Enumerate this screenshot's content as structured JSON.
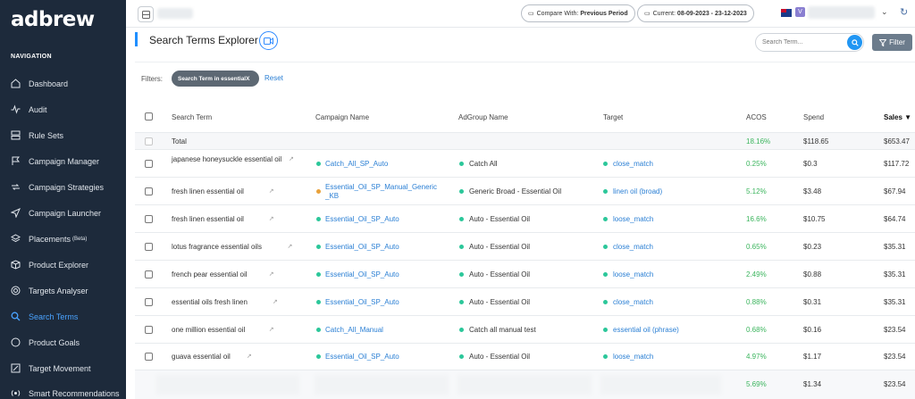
{
  "brand": {
    "logo_text": "adbrew"
  },
  "sidebar": {
    "heading": "NAVIGATION",
    "items": [
      {
        "label": "Dashboard",
        "icon": "home-icon"
      },
      {
        "label": "Audit",
        "icon": "pulse-icon"
      },
      {
        "label": "Rule Sets",
        "icon": "rules-icon"
      },
      {
        "label": "Campaign Manager",
        "icon": "flag-icon"
      },
      {
        "label": "Campaign Strategies",
        "icon": "repeat-icon"
      },
      {
        "label": "Campaign Launcher",
        "icon": "send-icon"
      },
      {
        "label": "Placements",
        "badge": "(Beta)",
        "icon": "layers-icon"
      },
      {
        "label": "Product Explorer",
        "icon": "box-icon"
      },
      {
        "label": "Targets Analyser",
        "icon": "target-icon"
      },
      {
        "label": "Search Terms",
        "icon": "search-icon",
        "active": true
      },
      {
        "label": "Product Goals",
        "icon": "circle-icon"
      },
      {
        "label": "Target Movement",
        "icon": "edit-icon"
      },
      {
        "label": "Smart Recommendations",
        "icon": "radio-icon"
      }
    ]
  },
  "topbar": {
    "compare_prefix": "Compare With:",
    "compare_value": "Previous Period",
    "current_prefix": "Current:",
    "current_value": "08-09-2023 - 23-12-2023",
    "avatar_letter": "V"
  },
  "page": {
    "title": "Search Terms Explorer",
    "search_placeholder": "Search Term...",
    "filter_button": "Filter",
    "filters_label": "Filters:",
    "active_filter": "Search Term in essential",
    "active_filter_close": "X",
    "reset": "Reset"
  },
  "table": {
    "columns": [
      "Search Term",
      "Campaign Name",
      "AdGroup Name",
      "Target",
      "ACOS",
      "Spend",
      "Sales"
    ],
    "sort_indicator": "▼",
    "total": {
      "label": "Total",
      "acos": "18.16%",
      "spend": "$118.65",
      "sales": "$653.47"
    },
    "rows": [
      {
        "term": "japanese honeysuckle essential oil",
        "campaign": "Catch_All_SP_Auto",
        "campaign_status": "green",
        "adgroup": "Catch All",
        "target": "close_match",
        "acos": "0.25%",
        "spend": "$0.3",
        "sales": "$117.72"
      },
      {
        "term": "fresh linen essential oil",
        "campaign": "Essential_Oil_SP_Manual_Generic_KB",
        "campaign_status": "orange",
        "adgroup": "Generic Broad - Essential Oil",
        "target": "linen oil (broad)",
        "acos": "5.12%",
        "spend": "$3.48",
        "sales": "$67.94"
      },
      {
        "term": "fresh linen essential oil",
        "campaign": "Essential_Oil_SP_Auto",
        "campaign_status": "green",
        "adgroup": "Auto - Essential Oil",
        "target": "loose_match",
        "acos": "16.6%",
        "spend": "$10.75",
        "sales": "$64.74"
      },
      {
        "term": "lotus fragrance essential oils",
        "campaign": "Essential_Oil_SP_Auto",
        "campaign_status": "green",
        "adgroup": "Auto - Essential Oil",
        "target": "close_match",
        "acos": "0.65%",
        "spend": "$0.23",
        "sales": "$35.31"
      },
      {
        "term": "french pear essential oil",
        "campaign": "Essential_Oil_SP_Auto",
        "campaign_status": "green",
        "adgroup": "Auto - Essential Oil",
        "target": "loose_match",
        "acos": "2.49%",
        "spend": "$0.88",
        "sales": "$35.31"
      },
      {
        "term": "essential oils fresh linen",
        "campaign": "Essential_Oil_SP_Auto",
        "campaign_status": "green",
        "adgroup": "Auto - Essential Oil",
        "target": "close_match",
        "acos": "0.88%",
        "spend": "$0.31",
        "sales": "$35.31"
      },
      {
        "term": "one million essential oil",
        "campaign": "Catch_All_Manual",
        "campaign_status": "green",
        "adgroup": "Catch all manual test",
        "target": "essential oil (phrase)",
        "acos": "0.68%",
        "spend": "$0.16",
        "sales": "$23.54"
      },
      {
        "term": "guava essential oil",
        "campaign": "Essential_Oil_SP_Auto",
        "campaign_status": "green",
        "adgroup": "Auto - Essential Oil",
        "target": "loose_match",
        "acos": "4.97%",
        "spend": "$1.17",
        "sales": "$23.54"
      }
    ],
    "partial_row": {
      "acos": "5.69%",
      "spend": "$1.34",
      "sales": "$23.54"
    }
  },
  "colors": {
    "sidebar_bg": "#1d2a3b",
    "accent": "#2196f3",
    "positive": "#3cb55e",
    "link": "#2a7fd4"
  }
}
